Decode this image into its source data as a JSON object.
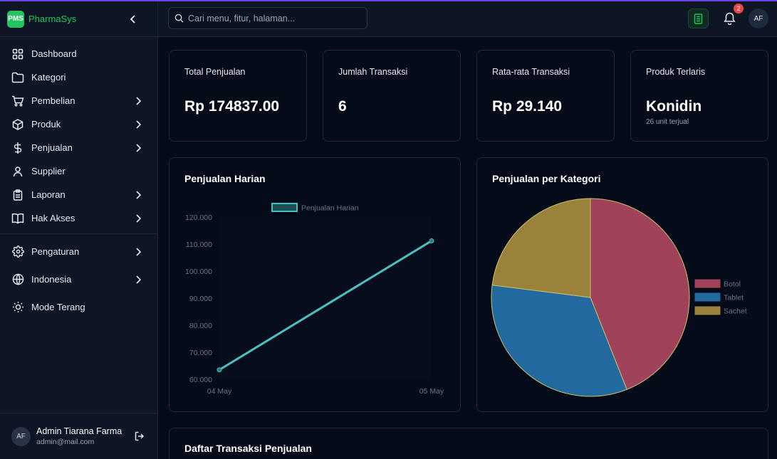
{
  "brand": {
    "logo": "PMS",
    "name": "PharmaSys"
  },
  "sidebar": {
    "items": [
      {
        "label": "Dashboard",
        "icon": "grid-icon",
        "chevron": false
      },
      {
        "label": "Kategori",
        "icon": "folder-icon",
        "chevron": false
      },
      {
        "label": "Pembelian",
        "icon": "cart-icon",
        "chevron": true
      },
      {
        "label": "Produk",
        "icon": "box-icon",
        "chevron": true
      },
      {
        "label": "Penjualan",
        "icon": "dollar-icon",
        "chevron": true
      },
      {
        "label": "Supplier",
        "icon": "user-icon",
        "chevron": false
      },
      {
        "label": "Laporan",
        "icon": "clipboard-icon",
        "chevron": true
      },
      {
        "label": "Hak Akses",
        "icon": "book-icon",
        "chevron": true
      }
    ],
    "settings": [
      {
        "label": "Pengaturan",
        "icon": "gear-icon",
        "chevron": true
      },
      {
        "label": "Indonesia",
        "icon": "globe-icon",
        "chevron": true
      },
      {
        "label": "Mode Terang",
        "icon": "sun-icon",
        "chevron": false
      }
    ],
    "user": {
      "initials": "AF",
      "name": "Admin Tiarana Farma",
      "email": "admin@mail.com"
    }
  },
  "topbar": {
    "search_placeholder": "Cari menu, fitur, halaman...",
    "notification_count": "2",
    "avatar_initials": "AF"
  },
  "stats": [
    {
      "label": "Total Penjualan",
      "value": "Rp 174837.00"
    },
    {
      "label": "Jumlah Transaksi",
      "value": "6"
    },
    {
      "label": "Rata-rata Transaksi",
      "value": "Rp 29.140"
    },
    {
      "label": "Produk Terlaris",
      "value": "Konidin",
      "sub": "26 unit terjual"
    }
  ],
  "panels": {
    "daily_title": "Penjualan Harian",
    "category_title": "Penjualan per Kategori",
    "transactions_title": "Daftar Transaksi Penjualan"
  },
  "colors": {
    "accent": "#22c55e",
    "line": "#4bc0c0",
    "botol": "#a0425a",
    "tablet": "#2269a0",
    "sachet": "#9a823a"
  },
  "chart_data": [
    {
      "type": "line",
      "title": "",
      "x": [
        "04 May",
        "05 May"
      ],
      "series": [
        {
          "name": "Penjualan Harian",
          "values": [
            63500,
            111200
          ]
        }
      ],
      "ylim": [
        60000,
        120000
      ],
      "yticks": [
        "60.000",
        "70.000",
        "80.000",
        "90.000",
        "100.000",
        "110.000",
        "120.000"
      ],
      "legend": "top"
    },
    {
      "type": "pie",
      "title": "",
      "categories": [
        "Botol",
        "Tablet",
        "Sachet"
      ],
      "values": [
        44,
        33,
        23
      ],
      "legend": "right"
    }
  ]
}
